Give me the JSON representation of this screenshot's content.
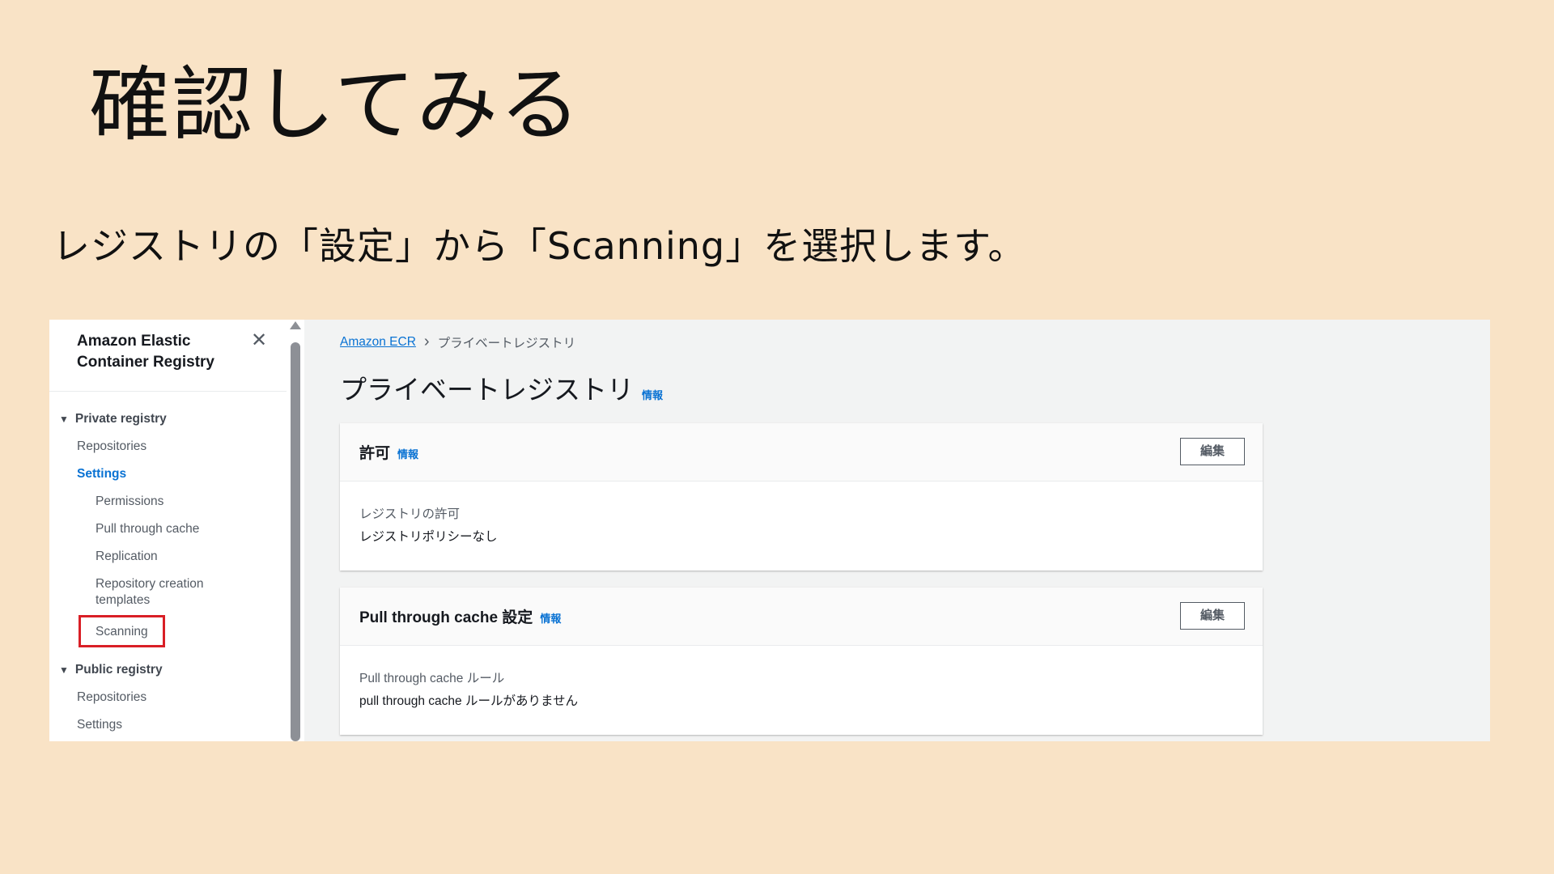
{
  "slide": {
    "title": "確認してみる",
    "subtitle": "レジストリの「設定」から「Scanning」を選択します。"
  },
  "sidebar": {
    "title": "Amazon Elastic Container Registry",
    "private_section": "Private registry",
    "private_items": {
      "repositories": "Repositories",
      "settings": "Settings",
      "permissions": "Permissions",
      "pull_through_cache": "Pull through cache",
      "replication": "Replication",
      "repository_creation_templates": "Repository creation templates",
      "scanning": "Scanning"
    },
    "public_section": "Public registry",
    "public_items": {
      "repositories": "Repositories",
      "settings": "Settings"
    }
  },
  "breadcrumb": {
    "root": "Amazon ECR",
    "current": "プライベートレジストリ"
  },
  "page": {
    "title": "プライベートレジストリ",
    "info": "情報"
  },
  "panels": [
    {
      "title": "許可",
      "info": "情報",
      "edit": "編集",
      "key": "レジストリの許可",
      "value": "レジストリポリシーなし"
    },
    {
      "title": "Pull through cache 設定",
      "info": "情報",
      "edit": "編集",
      "key": "Pull through cache ルール",
      "value": "pull through cache ルールがありません"
    }
  ],
  "colors": {
    "background": "#f9e3c6",
    "link": "#0972d3",
    "highlight": "#d91f26"
  }
}
